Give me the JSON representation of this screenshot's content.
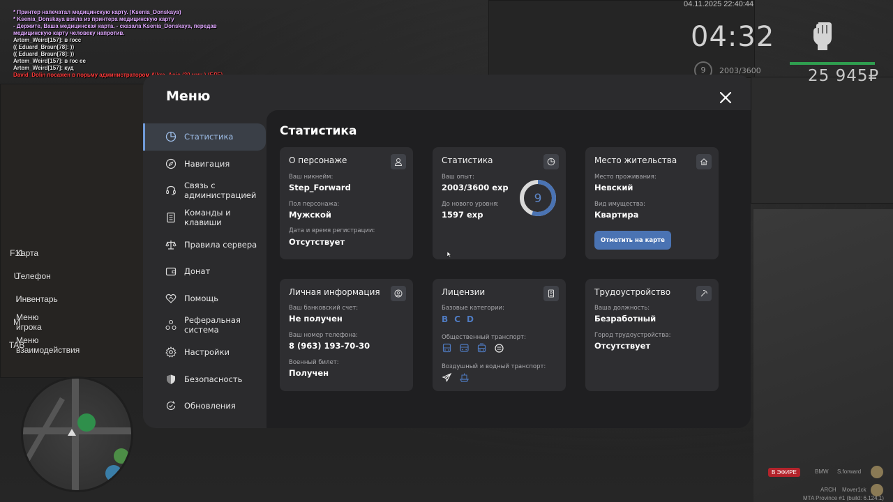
{
  "chat": [
    {
      "text": "* Принтер напечатал медицинскую карту. (Ksenia_Donskaya)",
      "color": "#e0a8ff"
    },
    {
      "text": "* Ksenia_Donskaya взяла из принтера медицинскую карту",
      "color": "#e0a8ff"
    },
    {
      "text": "- Держите, Ваша медицинская карта, - сказала Ksenia_Donskaya, передав",
      "color": "#e0a8ff"
    },
    {
      "text": "медицинскую карту человеку напротив.",
      "color": "#e0a8ff"
    },
    {
      "text": "Artem_Weird[157]: в госс",
      "color": "#e8e8e8"
    },
    {
      "text": "(( Eduard_Braun[78]: ))",
      "color": "#e8e8e8"
    },
    {
      "text": "(( Eduard_Braun[78]: ))",
      "color": "#e8e8e8"
    },
    {
      "text": "Artem_Weird[157]: в гос ее",
      "color": "#e8e8e8"
    },
    {
      "text": "Artem_Weird[157]: куд",
      "color": "#e8e8e8"
    },
    {
      "text": "David_Dolin посажен в порьму администратором Alkra_Aoio (30 мин.) (ЕЛЕ)",
      "color": "#ff3b3b"
    }
  ],
  "hud": {
    "datetime": "04.11.2025 22:40:44",
    "time": "04:32",
    "level": "9",
    "exp": "2003/3600",
    "money": "25 945₽"
  },
  "binds": [
    {
      "key": "F11",
      "label": "Карта"
    },
    {
      "key": "U",
      "label": "Телефон"
    },
    {
      "key": "I",
      "label": "Инвентарь"
    },
    {
      "key": "M",
      "label": "Меню игрока"
    },
    {
      "key": "TAB",
      "label": "Меню взаимодействия"
    }
  ],
  "bottom_right": {
    "live": "В ЭФИРЕ",
    "car": "BMW",
    "name": "S.forward",
    "arch": "ARCH",
    "mover": "Mover1ck",
    "build": "MTA Province #1 (build: 6.124.1)"
  },
  "menu": {
    "title": "Меню",
    "content_title": "Статистика",
    "nav": [
      {
        "label": "Статистика",
        "icon": "pie-chart-icon"
      },
      {
        "label": "Навигация",
        "icon": "compass-icon"
      },
      {
        "label": "Связь с администрацией",
        "icon": "headset-icon"
      },
      {
        "label": "Команды и клавиши",
        "icon": "document-icon"
      },
      {
        "label": "Правила сервера",
        "icon": "scales-icon"
      },
      {
        "label": "Донат",
        "icon": "wallet-icon"
      },
      {
        "label": "Помощь",
        "icon": "heart-handshake-icon"
      },
      {
        "label": "Реферальная система",
        "icon": "referral-icon"
      },
      {
        "label": "Настройки",
        "icon": "gear-icon"
      },
      {
        "label": "Безопасность",
        "icon": "shield-icon"
      },
      {
        "label": "Обновления",
        "icon": "update-icon"
      }
    ]
  },
  "cards": {
    "character": {
      "title": "О персонаже",
      "nickname_label": "Ваш никнейм:",
      "nickname": "Step_Forward",
      "gender_label": "Пол персонажа:",
      "gender": "Мужской",
      "reg_label": "Дата и время регистрации:",
      "reg": "Отсутствует"
    },
    "stats": {
      "title": "Статистика",
      "exp_label": "Ваш опыт:",
      "exp": "2003/3600 exp",
      "next_label": "До нового уровня:",
      "next": "1597 exp",
      "level": "9",
      "progress": 0.556
    },
    "residence": {
      "title": "Место жительства",
      "place_label": "Место проживания:",
      "place": "Невский",
      "type_label": "Вид имущества:",
      "type": "Квартира",
      "button": "Отметить на карте"
    },
    "personal": {
      "title": "Личная информация",
      "bank_label": "Ваш банковский счет:",
      "bank": "Не получен",
      "phone_label": "Ваш номер телефона:",
      "phone": "8 (963) 193-70-30",
      "military_label": "Военный билет:",
      "military": "Получен"
    },
    "licenses": {
      "title": "Лицензии",
      "base_label": "Базовые категории:",
      "categories": [
        "B",
        "C",
        "D"
      ],
      "public_label": "Общественный транспорт:",
      "air_label": "Воздушный и водный транспорт:"
    },
    "job": {
      "title": "Трудоустройство",
      "position_label": "Ваша должность:",
      "position": "Безработный",
      "city_label": "Город трудоустройства:",
      "city": "Отсутствует"
    }
  }
}
